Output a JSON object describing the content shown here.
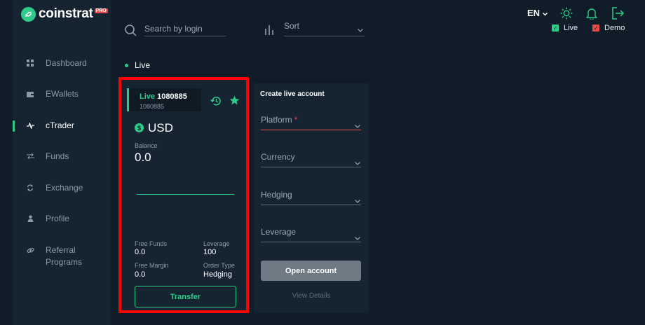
{
  "brand": {
    "name": "coinstrat",
    "badge": "PRO"
  },
  "sidebar": {
    "items": [
      {
        "label": "Dashboard",
        "icon": "grid-icon"
      },
      {
        "label": "EWallets",
        "icon": "wallet-icon"
      },
      {
        "label": "cTrader",
        "icon": "pulse-icon",
        "active": true
      },
      {
        "label": "Funds",
        "icon": "arrows-icon"
      },
      {
        "label": "Exchange",
        "icon": "refresh-icon"
      },
      {
        "label": "Profile",
        "icon": "person-icon"
      },
      {
        "label": "Referral Programs",
        "label_line1": "Referral",
        "label_line2": "Programs",
        "icon": "link-icon"
      }
    ]
  },
  "toolbar": {
    "search_placeholder": "Search by login",
    "sort_label": "Sort"
  },
  "header": {
    "language": "EN",
    "legend": [
      {
        "label": "Live",
        "color": "#2ecc8a"
      },
      {
        "label": "Demo",
        "color": "#e5484d"
      }
    ]
  },
  "section": {
    "title": "Live"
  },
  "account": {
    "type": "Live",
    "number": "1080885",
    "login": "1080885",
    "currency_symbol": "$",
    "currency": "USD",
    "balance_label": "Balance",
    "balance": "0.0",
    "free_funds_label": "Free Funds",
    "free_funds": "0.0",
    "leverage_label": "Leverage",
    "leverage": "100",
    "free_margin_label": "Free Margin",
    "free_margin": "0.0",
    "order_type_label": "Order Type",
    "order_type": "Hedging",
    "transfer_label": "Transfer"
  },
  "create_account": {
    "title": "Create live account",
    "fields": [
      {
        "label": "Platform",
        "required": "*"
      },
      {
        "label": "Currency"
      },
      {
        "label": "Hedging"
      },
      {
        "label": "Leverage"
      }
    ],
    "open_label": "Open account",
    "view_details_label": "View Details"
  },
  "colors": {
    "accent": "#2ecc8a",
    "danger": "#e5484d",
    "highlight": "#ff0000"
  }
}
